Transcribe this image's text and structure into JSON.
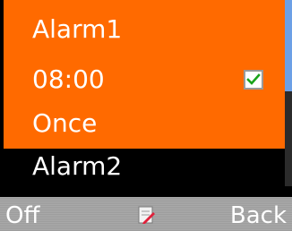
{
  "alarm_list": {
    "selected_alarm": {
      "name": "Alarm1",
      "time": "08:00",
      "enabled_icon": "checkbox-checked-icon",
      "repeat": "Once"
    },
    "items": [
      {
        "name": "Alarm2"
      }
    ]
  },
  "softkeys": {
    "left_label": "Off",
    "center_icon": "edit-icon",
    "right_label": "Back"
  },
  "colors": {
    "highlight": "#FF6A00",
    "background": "#000000",
    "softkey_bar": "#A9A9A9",
    "scroll_thumb": "#6CA0E6",
    "check_mark": "#1AA31A"
  }
}
